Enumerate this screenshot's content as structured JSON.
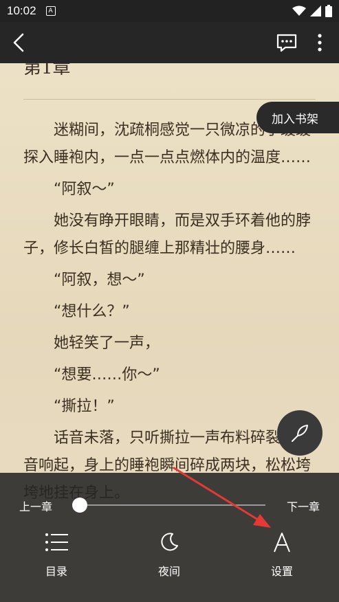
{
  "status_bar": {
    "time": "10:02",
    "notification_icon": "A"
  },
  "app_bar": {
    "back_icon": "chevron-left-icon",
    "comment_icon": "comment-icon",
    "more_icon": "more-vertical-icon"
  },
  "reader": {
    "chapter_title": "第1章",
    "paragraphs": [
      "迷糊间，沈疏桐感觉一只微凉的手缓缓探入睡袍内，一点一点点燃体内的温度……",
      "“阿叙～”",
      "她没有睁开眼睛，而是双手环着他的脖子，修长白皙的腿缠上那精壮的腰身……",
      "“阿叙，想～”",
      "“想什么？”",
      "她轻笑了一声，",
      "“想要……你～”",
      "“撕拉！”",
      "话音未落，只听撕拉一声布料碎裂的声音响起，身上的睡袍瞬间碎成两块，松松垮垮地挂在身上。"
    ],
    "add_to_shelf": "加入书架"
  },
  "bottom_panel": {
    "prev_chapter": "上一章",
    "next_chapter": "下一章",
    "progress": 0.02,
    "tabs": {
      "catalog": "目录",
      "night": "夜间",
      "settings": "设置"
    }
  },
  "colors": {
    "bar_bg": "#262626",
    "paper": "#e9dcc0",
    "text": "#3b2f22",
    "arrow": "#e53935"
  }
}
